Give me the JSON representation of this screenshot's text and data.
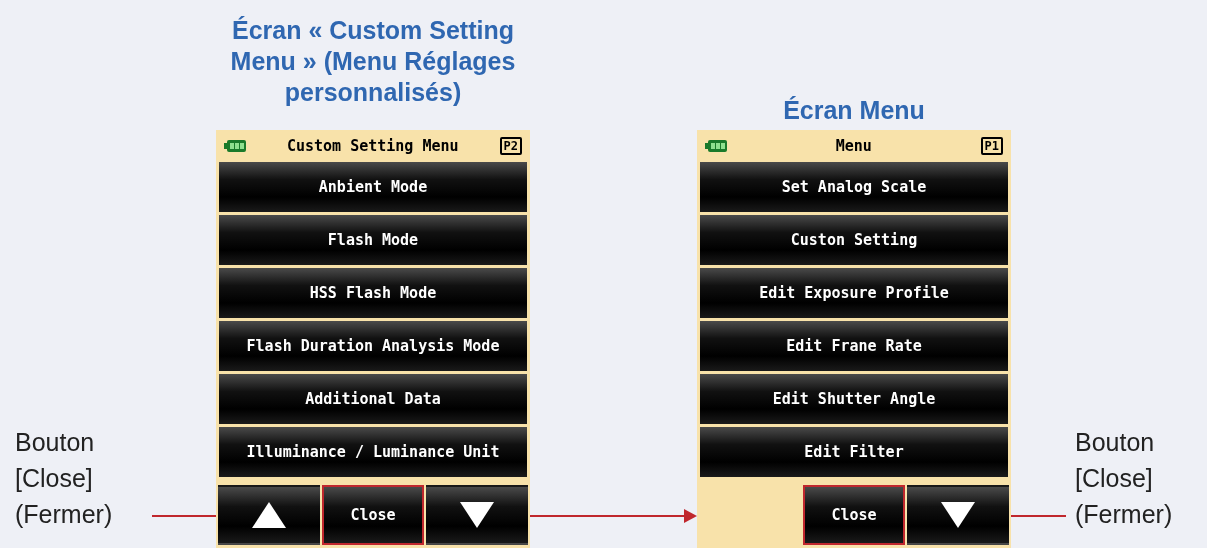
{
  "callouts": [
    {
      "text": "Bouton [Close] (Fermer)"
    },
    {
      "text": "Bouton [Close] (Fermer)"
    }
  ],
  "screens": [
    {
      "heading": "Écran « Custom Setting Menu » (Menu Réglages personnalisés)",
      "title": "Custom Setting Menu",
      "page": "P2",
      "items": [
        "Anbient Mode",
        "Flash Mode",
        "HSS Flash Mode",
        "Flash Duration Analysis Mode",
        "Additional Data",
        "Illuminance / Luminance Unit"
      ],
      "nav": [
        {
          "kind": "up"
        },
        {
          "kind": "close",
          "label": "Close",
          "highlighted": true
        },
        {
          "kind": "down"
        }
      ]
    },
    {
      "heading": "Écran Menu",
      "title": "Menu",
      "page": "P1",
      "items": [
        "Set Analog Scale",
        "Custon Setting",
        "Edit Exposure Profile",
        "Edit Frane Rate",
        "Edit Shutter Angle",
        "Edit Filter"
      ],
      "nav": [
        {
          "kind": "close",
          "label": "Close",
          "highlighted": true
        },
        {
          "kind": "down"
        }
      ]
    }
  ]
}
